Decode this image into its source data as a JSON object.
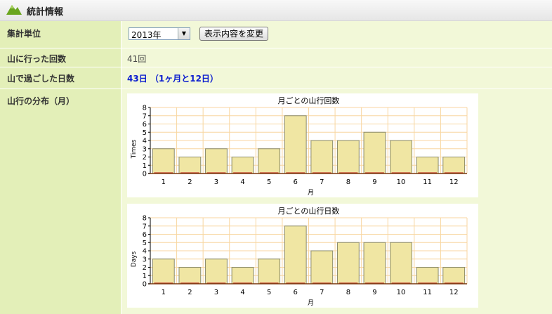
{
  "header": {
    "title": "統計情報",
    "icon": "mountain-icon"
  },
  "unit": {
    "label": "集計単位",
    "selected": "2013年",
    "button_label": "表示内容を変更"
  },
  "visits": {
    "label": "山に行った回数",
    "value": "41回"
  },
  "days": {
    "label": "山で過ごした日数",
    "value": "43日 （1ヶ月と12日）"
  },
  "distribution": {
    "label": "山行の分布（月）"
  },
  "colors": {
    "header_cell": "#e3efb8",
    "value_cell": "#f2f8d8",
    "bar_fill": "#f0e6a3",
    "grid": "#f8d6a0",
    "link": "#0a1ccf"
  },
  "chart_data": [
    {
      "type": "bar",
      "title": "月ごとの山行回数",
      "xlabel": "月",
      "ylabel": "Times",
      "categories": [
        "1",
        "2",
        "3",
        "4",
        "5",
        "6",
        "7",
        "8",
        "9",
        "10",
        "11",
        "12"
      ],
      "values": [
        3,
        2,
        3,
        2,
        3,
        7,
        4,
        4,
        5,
        4,
        2,
        2
      ],
      "ylim": [
        0,
        8
      ],
      "yticks": [
        "0",
        "1",
        "2",
        "3",
        "4",
        "5",
        "6",
        "7",
        "8"
      ],
      "grid": true
    },
    {
      "type": "bar",
      "title": "月ごとの山行日数",
      "xlabel": "月",
      "ylabel": "Days",
      "categories": [
        "1",
        "2",
        "3",
        "4",
        "5",
        "6",
        "7",
        "8",
        "9",
        "10",
        "11",
        "12"
      ],
      "values": [
        3,
        2,
        3,
        2,
        3,
        7,
        4,
        5,
        5,
        5,
        2,
        2
      ],
      "ylim": [
        0,
        8
      ],
      "yticks": [
        "0",
        "1",
        "2",
        "3",
        "4",
        "5",
        "6",
        "7",
        "8"
      ],
      "grid": true
    }
  ]
}
